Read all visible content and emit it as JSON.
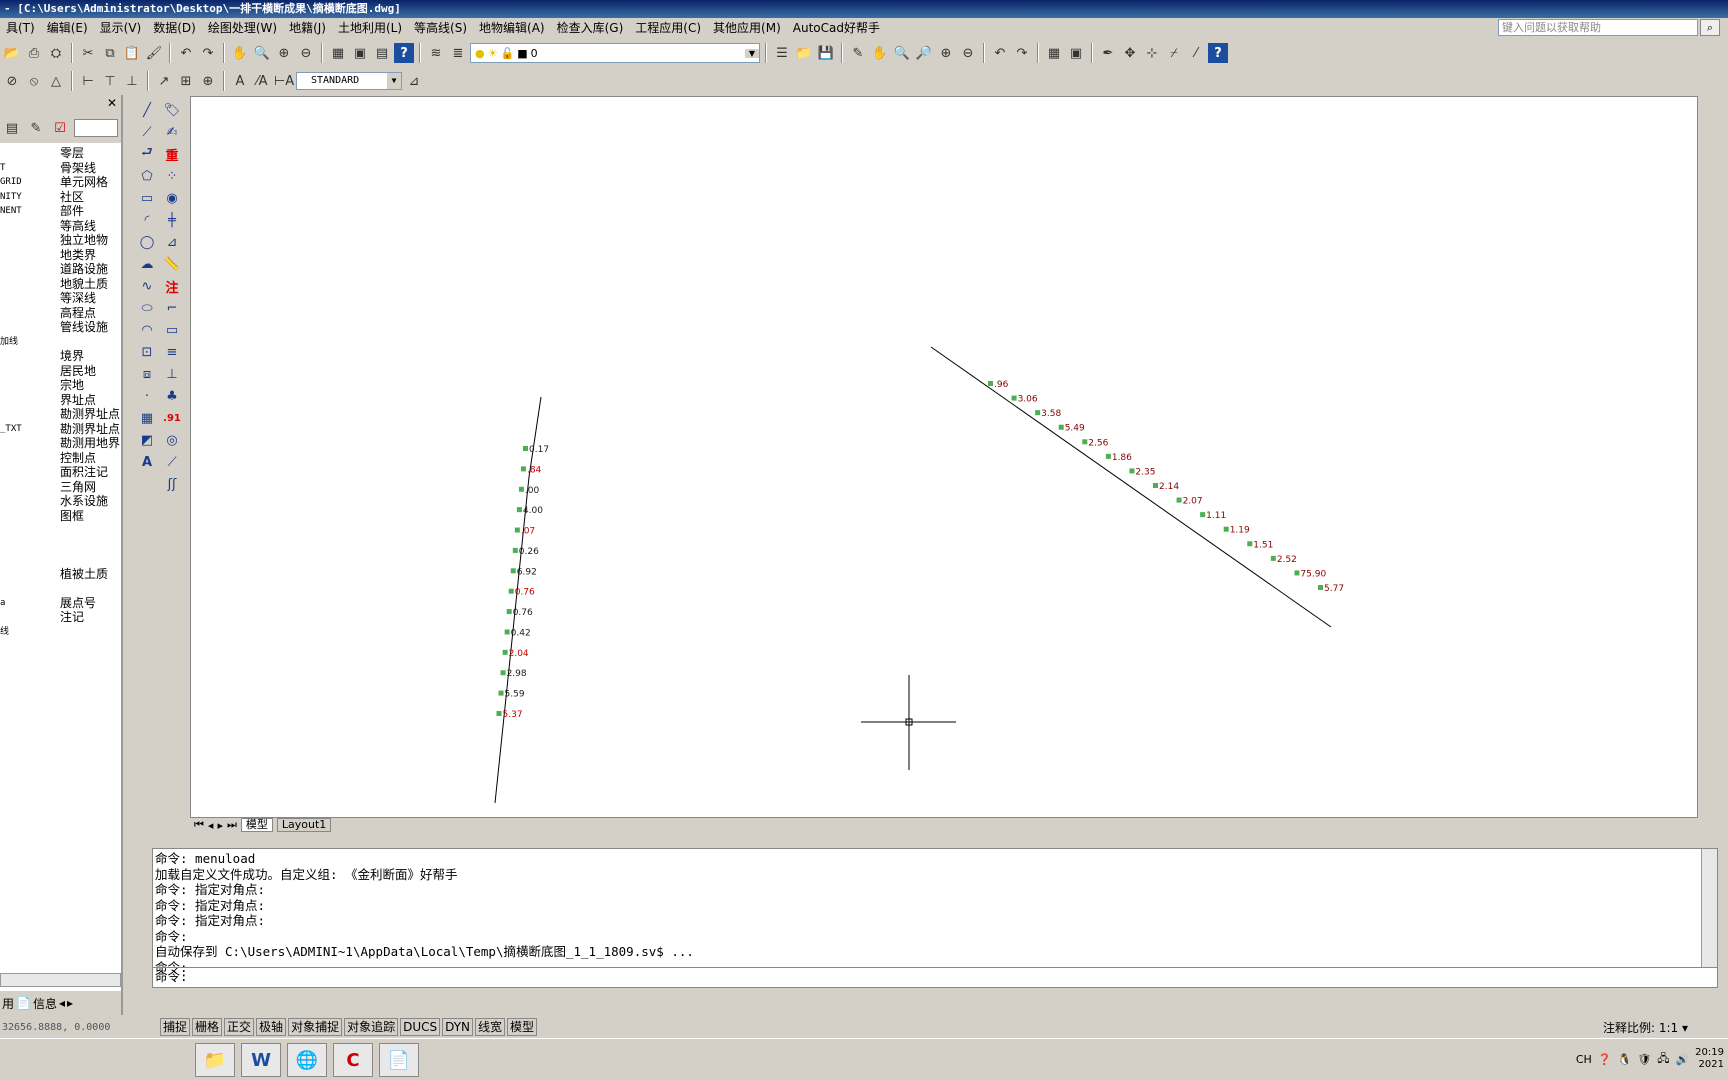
{
  "window": {
    "title": "- [C:\\Users\\Administrator\\Desktop\\一排干横断成果\\摘横断底图.dwg]"
  },
  "menu": [
    "具(T)",
    "编辑(E)",
    "显示(V)",
    "数据(D)",
    "绘图处理(W)",
    "地籍(J)",
    "土地利用(L)",
    "等高线(S)",
    "地物编辑(A)",
    "检查入库(G)",
    "工程应用(C)",
    "其他应用(M)",
    "AutoCad好帮手"
  ],
  "help_search": {
    "placeholder": "键入问题以获取帮助"
  },
  "toolbar": {
    "layer_value": "0",
    "text_style": "STANDARD"
  },
  "left_panel": {
    "layers": [
      {
        "code": "",
        "name": "零层"
      },
      {
        "code": "T",
        "name": "骨架线"
      },
      {
        "code": "GRID",
        "name": "单元网格"
      },
      {
        "code": "NITY",
        "name": "社区"
      },
      {
        "code": "NENT",
        "name": "部件"
      },
      {
        "code": "",
        "name": "等高线"
      },
      {
        "code": "",
        "name": "独立地物"
      },
      {
        "code": "",
        "name": "地类界"
      },
      {
        "code": "",
        "name": "道路设施"
      },
      {
        "code": "",
        "name": "地貌土质"
      },
      {
        "code": "",
        "name": "等深线"
      },
      {
        "code": "",
        "name": "高程点"
      },
      {
        "code": "",
        "name": "管线设施"
      },
      {
        "code": "加线",
        "name": ""
      },
      {
        "code": "",
        "name": "境界"
      },
      {
        "code": "",
        "name": "居民地"
      },
      {
        "code": "",
        "name": "宗地"
      },
      {
        "code": "",
        "name": "界址点"
      },
      {
        "code": "",
        "name": "勘测界址点"
      },
      {
        "code": "_TXT",
        "name": "勘测界址点"
      },
      {
        "code": "",
        "name": "勘测用地界"
      },
      {
        "code": "",
        "name": "控制点"
      },
      {
        "code": "",
        "name": "面积注记"
      },
      {
        "code": "",
        "name": "三角网"
      },
      {
        "code": "",
        "name": "水系设施"
      },
      {
        "code": "",
        "name": "图框"
      },
      {
        "code": "",
        "name": "植被土质"
      },
      {
        "code": "a",
        "name": "展点号"
      },
      {
        "code": "",
        "name": "注记"
      },
      {
        "code": "线",
        "name": ""
      }
    ],
    "tab_use": "用",
    "tab_info": "信息"
  },
  "canvas": {
    "left_labels": [
      "0.17",
      ".84",
      ".00",
      "4.00",
      ".07",
      "0.26",
      "6.92",
      "0.76",
      "0.76",
      "0.42",
      "2.04",
      "2.98",
      "5.59",
      "5.37"
    ],
    "right_labels": [
      ".96",
      "3.06",
      "3.58",
      "5.49",
      "2.56",
      "1.86",
      "2.35",
      "2.14",
      "2.07",
      "1.11",
      "1.19",
      "1.51",
      "2.52",
      "75.90",
      "5.77"
    ]
  },
  "layout_tabs": {
    "model": "模型",
    "layout": "Layout1"
  },
  "command": {
    "history": [
      "命令: menuload",
      "加载自定义文件成功。自定义组: 《金利断面》好帮手",
      "命令: 指定对角点:",
      "命令: 指定对角点:",
      "命令: 指定对角点:",
      "命令:",
      "自动保存到 C:\\Users\\ADMINI~1\\AppData\\Local\\Temp\\摘横断底图_1_1_1809.sv$ ...",
      "命令:"
    ],
    "prompt": "命令:"
  },
  "status": {
    "coords": "32656.8888, 0.0000",
    "buttons": [
      "捕捉",
      "栅格",
      "正交",
      "极轴",
      "对象捕捉",
      "对象追踪",
      "DUCS",
      "DYN",
      "线宽",
      "模型"
    ],
    "scale": "注释比例: 1:1 ▾"
  },
  "taskbar": {
    "lang": "CH",
    "time": "20:19",
    "year": "2021"
  }
}
